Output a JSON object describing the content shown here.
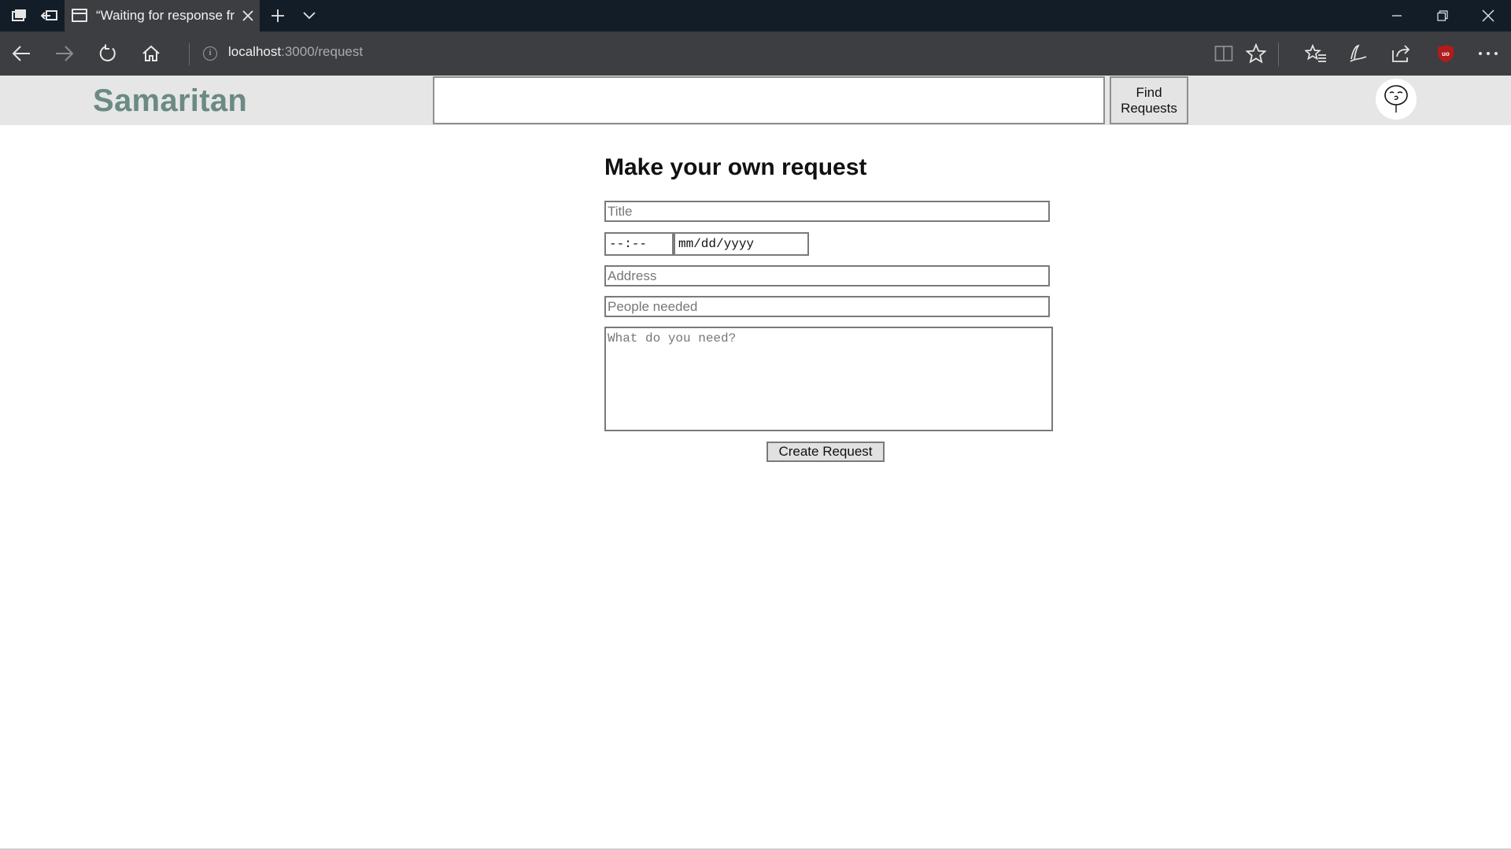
{
  "browser": {
    "tab_title": "“Waiting for response fr",
    "url_host": "localhost",
    "url_path": ":3000/request",
    "icons": [
      "tab-manager-icon",
      "set-aside-tabs-icon",
      "tab-page-icon",
      "close-icon",
      "new-tab-icon",
      "tab-list-chevron-icon",
      "minimize-icon",
      "restore-icon",
      "window-close-icon",
      "back-icon",
      "forward-icon",
      "refresh-icon",
      "home-icon",
      "info-icon",
      "reading-view-icon",
      "favorite-star-icon",
      "favorites-hub-icon",
      "pen-icon",
      "share-icon",
      "ublock-icon",
      "more-icon"
    ]
  },
  "header": {
    "logo": "Samaritan",
    "search_value": "",
    "find_button_line1": "Find",
    "find_button_line2": "Requests",
    "avatar_icon": "avatar-face-icon"
  },
  "form": {
    "heading": "Make your own request",
    "title_placeholder": "Title",
    "time_placeholder": "--:--",
    "date_placeholder": "mm/dd/yyyy",
    "address_placeholder": "Address",
    "people_placeholder": "People needed",
    "need_placeholder": "What do you need?",
    "submit_label": "Create Request"
  },
  "colors": {
    "tabbar_bg": "#131d28",
    "navbar_bg": "#3c3e41",
    "header_bg": "#e6e6e6",
    "logo": "#6b8a84",
    "ublock_red": "#b41b1b"
  }
}
